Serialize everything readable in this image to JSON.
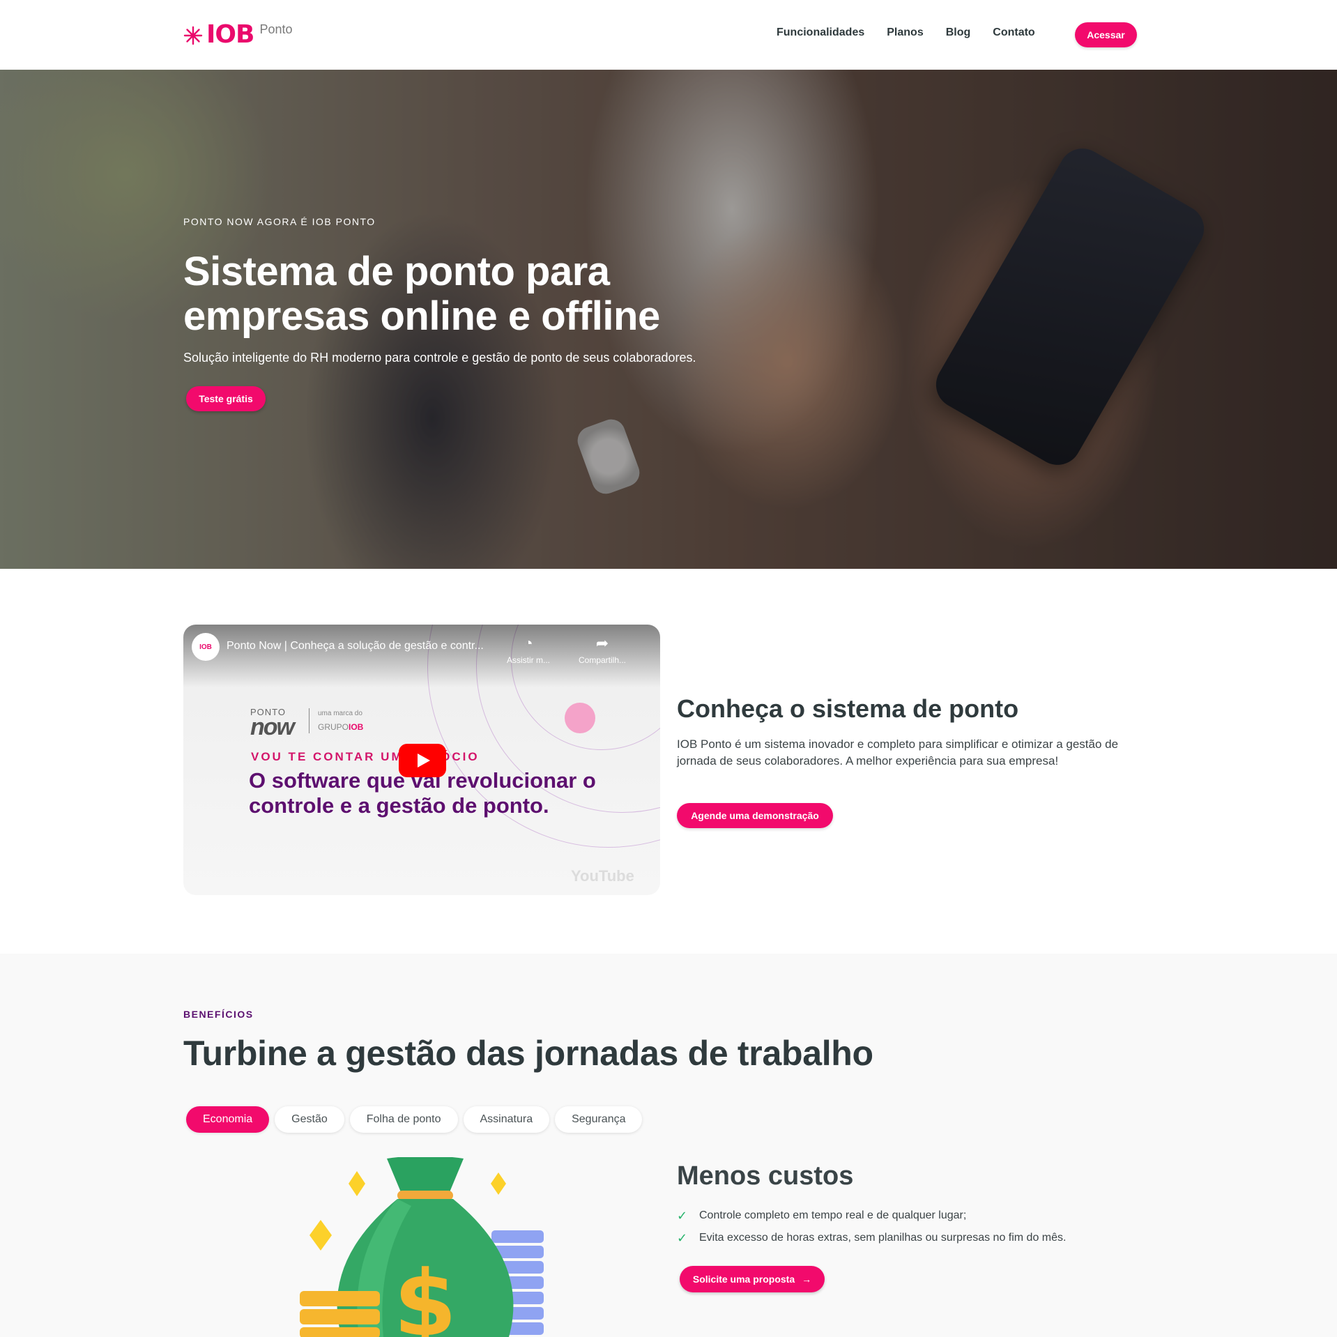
{
  "header": {
    "logo_text": "IOB",
    "logo_sub": "Ponto",
    "nav": [
      "Funcionalidades",
      "Planos",
      "Blog",
      "Contato"
    ],
    "cta": "Acessar"
  },
  "hero": {
    "eyebrow": "PONTO NOW AGORA É IOB PONTO",
    "title": "Sistema de ponto para empresas online e offline",
    "subtitle": "Solução inteligente do RH moderno para controle e gestão de ponto de seus colaboradores.",
    "cta": "Teste grátis"
  },
  "video": {
    "channel": "IOB",
    "title": "Ponto Now | Conheça a solução de gestão e contr...",
    "watch_later": "Assistir m...",
    "share": "Compartilh...",
    "brand_small": "PONTO",
    "brand_now": "now",
    "brand_marca": "uma marca do",
    "brand_grupo": "GRUPO",
    "brand_iob": "IOB",
    "kicker": "VOU TE CONTAR UM NEGÓCIO",
    "headline": "O software que vai revolucionar o controle e a gestão de ponto.",
    "youtube": "YouTube"
  },
  "conheca": {
    "title": "Conheça o sistema de ponto",
    "text": "IOB Ponto é um sistema inovador e completo para simplificar e otimizar a gestão de jornada de seus colaboradores. A melhor experiência para sua empresa!",
    "cta": "Agende uma demonstração"
  },
  "benefits": {
    "eyebrow": "BENEFÍCIOS",
    "title": "Turbine a gestão das jornadas de trabalho",
    "tabs": [
      "Economia",
      "Gestão",
      "Folha de ponto",
      "Assinatura",
      "Segurança"
    ],
    "active_tab": "Economia",
    "panel_title": "Menos custos",
    "items": [
      "Controle completo em tempo real e de qualquer lugar;",
      "Evita excesso de horas extras, sem planilhas ou surpresas no fim do mês."
    ],
    "cta": "Solicite uma proposta",
    "cta_arrow": "→"
  },
  "colors": {
    "accent": "#f20a6c",
    "dark_text": "#2f3a3d",
    "eyebrow_purple": "#5b1070",
    "check_green": "#27b36b"
  },
  "icons": {
    "logo": "asterisk-star-icon",
    "check": "check-icon",
    "play": "play-icon",
    "clock": "clock-icon",
    "share": "share-arrow-icon"
  }
}
